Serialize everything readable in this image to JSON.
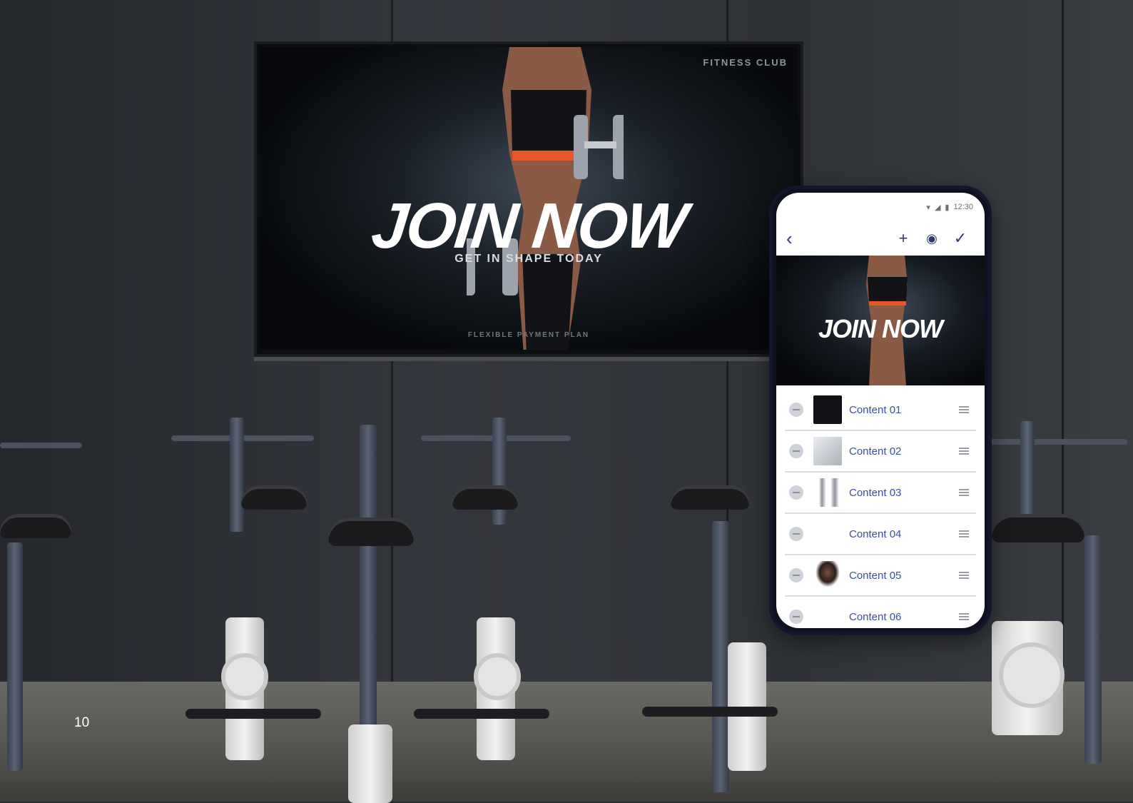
{
  "page": {
    "number": "10"
  },
  "tv": {
    "brand": "FITNESS CLUB",
    "headline": "JOIN NOW",
    "subheadline": "GET IN SHAPE TODAY",
    "footer": "FLEXIBLE PAYMENT PLAN"
  },
  "phone": {
    "status": {
      "time": "12:30",
      "icons": [
        "wifi-icon",
        "signal-icon",
        "battery-icon"
      ]
    },
    "app_bar": {
      "back_icon": "chevron-left-icon",
      "actions": [
        {
          "icon": "plus-icon",
          "glyph": "+"
        },
        {
          "icon": "eye-icon",
          "glyph": "◉"
        },
        {
          "icon": "check-icon",
          "glyph": "✓"
        }
      ]
    },
    "preview": {
      "headline": "JOIN NOW"
    },
    "content_items": [
      {
        "label": "Content 01"
      },
      {
        "label": "Content 02"
      },
      {
        "label": "Content 03"
      },
      {
        "label": "Content 04"
      },
      {
        "label": "Content 05"
      },
      {
        "label": "Content 06"
      }
    ]
  },
  "colors": {
    "accent": "#3b4ea8",
    "phone_frame": "#14162c",
    "tv_accent": "#e8572a"
  }
}
